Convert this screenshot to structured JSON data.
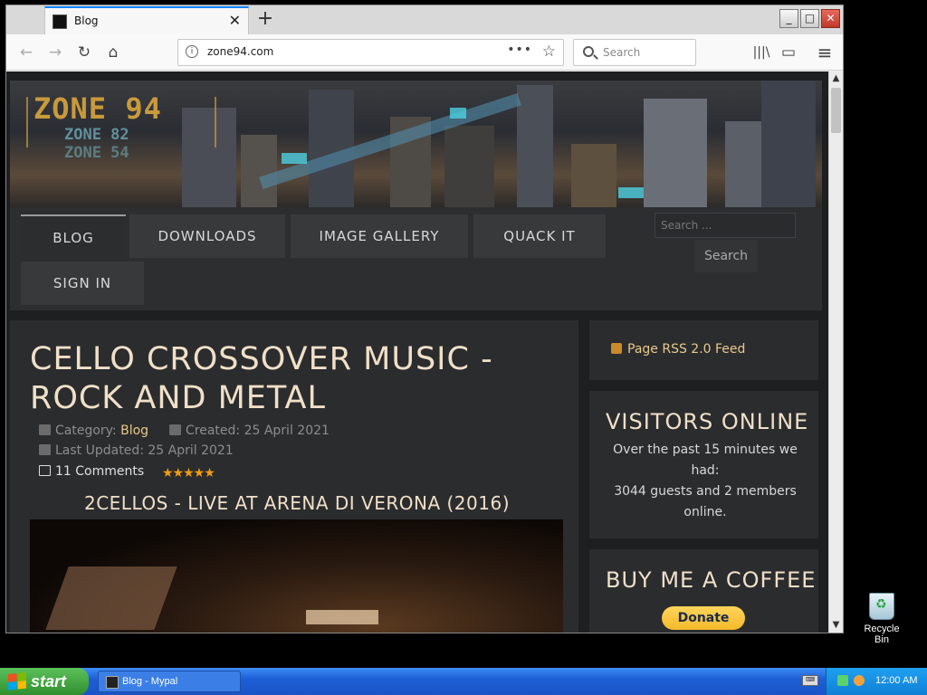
{
  "browser": {
    "tab_title": "Blog",
    "new_tab": "+",
    "tab_close": "✕",
    "url": "zone94.com",
    "url_menu": "•••",
    "bookmark": "☆",
    "search_placeholder": "Search",
    "nav": {
      "back": "←",
      "forward": "→",
      "reload": "↻",
      "home": "⌂"
    },
    "toolbar": {
      "library": "|||\\",
      "sidebar": "▭",
      "menu": "≡"
    },
    "window_controls": {
      "minimize": "_",
      "maximize": "□",
      "close": "✕"
    }
  },
  "site": {
    "logo_main": "ZONE 94",
    "logo_sub1": "ZONE 82",
    "logo_sub2": "ZONE 54",
    "menu": [
      {
        "label": "BLOG"
      },
      {
        "label": "DOWNLOADS"
      },
      {
        "label": "IMAGE GALLERY"
      },
      {
        "label": "QUACK IT"
      },
      {
        "label": "SIGN IN"
      }
    ],
    "search_placeholder": "Search ...",
    "search_button": "Search"
  },
  "article": {
    "title": "CELLO CROSSOVER MUSIC - ROCK AND METAL",
    "category_label": "Category:",
    "category": "Blog",
    "created": "Created: 25 April 2021",
    "updated": "Last Updated: 25 April 2021",
    "comments": "11 Comments",
    "rating": "★★★★★",
    "rating_value": 5,
    "video_title": "2CELLOS - LIVE AT ARENA DI VERONA (2016)"
  },
  "sidebar": {
    "rss": "Page RSS 2.0 Feed",
    "visitors_heading": "VISITORS ONLINE",
    "visitors_text_1": "Over the past 15 minutes we had:",
    "visitors_text_2": "3044 guests and 2 members online.",
    "coffee_heading": "BUY ME A COFFEE",
    "donate": "Donate"
  },
  "desktop": {
    "recycle_bin": "Recycle Bin"
  },
  "taskbar": {
    "start": "start",
    "task": "Blog - Mypal",
    "time": "12:00 AM"
  }
}
